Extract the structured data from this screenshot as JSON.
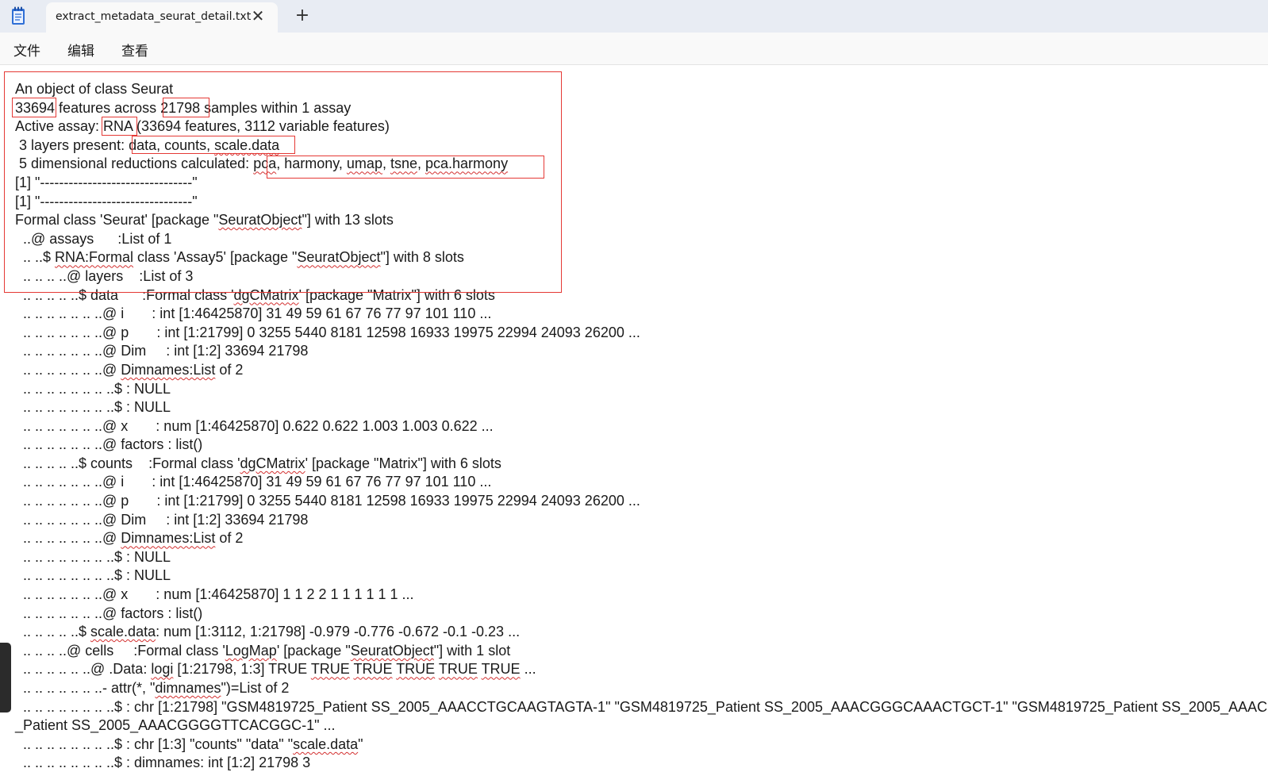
{
  "tab": {
    "title": "extract_metadata_seurat_detail.txt",
    "close_glyph": "✕",
    "new_tab_glyph": "+"
  },
  "icons": {
    "app": "notepad-icon",
    "close": "close-icon",
    "add": "plus-icon"
  },
  "menu": {
    "file": "文件",
    "edit": "编辑",
    "view": "查看"
  },
  "colors": {
    "highlight_box": "#e53935",
    "spellcheck": "#d32f2f",
    "tabbar": "#e8ecf3"
  },
  "lines": [
    [
      {
        "t": "An object of class Seurat"
      }
    ],
    [
      {
        "t": "33694 features across 21798 samples within 1 assay"
      }
    ],
    [
      {
        "t": "Active assay: RNA (33694 features, 3112 variable features)"
      }
    ],
    [
      {
        "t": " 3 layers present: data, counts, "
      },
      {
        "t": "scale.data",
        "s": 1
      }
    ],
    [
      {
        "t": " 5 dimensional reductions calculated: "
      },
      {
        "t": "pca",
        "s": 1
      },
      {
        "t": ", harmony, "
      },
      {
        "t": "umap",
        "s": 1
      },
      {
        "t": ", "
      },
      {
        "t": "tsne",
        "s": 1
      },
      {
        "t": ", "
      },
      {
        "t": "pca.harmony",
        "s": 1
      }
    ],
    [
      {
        "t": "[1] \"--------------------------------\""
      }
    ],
    [
      {
        "t": "[1] \"--------------------------------\""
      }
    ],
    [
      {
        "t": "Formal class 'Seurat' [package \""
      },
      {
        "t": "SeuratObject",
        "s": 1
      },
      {
        "t": "\"] with 13 slots"
      }
    ],
    [
      {
        "t": "  ..@ assays      :List of 1"
      }
    ],
    [
      {
        "t": "  .. ..$ "
      },
      {
        "t": "RNA:Formal",
        "s": 1
      },
      {
        "t": " class 'Assay5' [package \""
      },
      {
        "t": "SeuratObject",
        "s": 1
      },
      {
        "t": "\"] with 8 slots"
      }
    ],
    [
      {
        "t": "  .. .. .. ..@ layers    :List of 3"
      }
    ],
    [
      {
        "t": "  .. .. .. .. ..$ data      :Formal class '"
      },
      {
        "t": "dgCMatrix",
        "s": 1
      },
      {
        "t": "' [package \"Matrix\"] with 6 slots"
      }
    ],
    [
      {
        "t": "  .. .. .. .. .. .. ..@ i       : int [1:46425870] 31 49 59 61 67 76 77 97 101 110 ..."
      }
    ],
    [
      {
        "t": "  .. .. .. .. .. .. ..@ p       : int [1:21799] 0 3255 5440 8181 12598 16933 19975 22994 24093 26200 ..."
      }
    ],
    [
      {
        "t": "  .. .. .. .. .. .. ..@ Dim     : int [1:2] 33694 21798"
      }
    ],
    [
      {
        "t": "  .. .. .. .. .. .. ..@ "
      },
      {
        "t": "Dimnames:List",
        "s": 1
      },
      {
        "t": " of 2"
      }
    ],
    [
      {
        "t": "  .. .. .. .. .. .. .. ..$ : NULL"
      }
    ],
    [
      {
        "t": "  .. .. .. .. .. .. .. ..$ : NULL"
      }
    ],
    [
      {
        "t": "  .. .. .. .. .. .. ..@ x       : num [1:46425870] 0.622 0.622 1.003 1.003 0.622 ..."
      }
    ],
    [
      {
        "t": "  .. .. .. .. .. .. ..@ factors : list()"
      }
    ],
    [
      {
        "t": "  .. .. .. .. ..$ counts    :Formal class '"
      },
      {
        "t": "dgCMatrix",
        "s": 1
      },
      {
        "t": "' [package \"Matrix\"] with 6 slots"
      }
    ],
    [
      {
        "t": "  .. .. .. .. .. .. ..@ i       : int [1:46425870] 31 49 59 61 67 76 77 97 101 110 ..."
      }
    ],
    [
      {
        "t": "  .. .. .. .. .. .. ..@ p       : int [1:21799] 0 3255 5440 8181 12598 16933 19975 22994 24093 26200 ..."
      }
    ],
    [
      {
        "t": "  .. .. .. .. .. .. ..@ Dim     : int [1:2] 33694 21798"
      }
    ],
    [
      {
        "t": "  .. .. .. .. .. .. ..@ "
      },
      {
        "t": "Dimnames:List",
        "s": 1
      },
      {
        "t": " of 2"
      }
    ],
    [
      {
        "t": "  .. .. .. .. .. .. .. ..$ : NULL"
      }
    ],
    [
      {
        "t": "  .. .. .. .. .. .. .. ..$ : NULL"
      }
    ],
    [
      {
        "t": "  .. .. .. .. .. .. ..@ x       : num [1:46425870] 1 1 2 2 1 1 1 1 1 1 ..."
      }
    ],
    [
      {
        "t": "  .. .. .. .. .. .. ..@ factors : list()"
      }
    ],
    [
      {
        "t": "  .. .. .. .. ..$ "
      },
      {
        "t": "scale.data",
        "s": 1
      },
      {
        "t": ": num [1:3112, 1:21798] -0.979 -0.776 -0.672 -0.1 -0.23 ..."
      }
    ],
    [
      {
        "t": "  .. .. .. ..@ cells     :Formal class '"
      },
      {
        "t": "LogMap",
        "s": 1
      },
      {
        "t": "' [package \""
      },
      {
        "t": "SeuratObject",
        "s": 1
      },
      {
        "t": "\"] with 1 slot"
      }
    ],
    [
      {
        "t": "  .. .. .. .. .. ..@ .Data: "
      },
      {
        "t": "logi",
        "s": 1
      },
      {
        "t": " [1:21798, 1:3] TRUE "
      },
      {
        "t": "TRUE",
        "s": 1
      },
      {
        "t": " "
      },
      {
        "t": "TRUE",
        "s": 1
      },
      {
        "t": " "
      },
      {
        "t": "TRUE",
        "s": 1
      },
      {
        "t": " "
      },
      {
        "t": "TRUE",
        "s": 1
      },
      {
        "t": " "
      },
      {
        "t": "TRUE",
        "s": 1
      },
      {
        "t": " ..."
      }
    ],
    [
      {
        "t": "  .. .. .. .. .. .. ..- attr(*, \""
      },
      {
        "t": "dimnames",
        "s": 1
      },
      {
        "t": "\")=List of 2"
      }
    ],
    [
      {
        "t": "  .. .. .. .. .. .. .. ..$ : chr [1:21798] \"GSM4819725_Patient SS_2005_AAACCTGCAAGTAGTA-1\" \"GSM4819725_Patient SS_2005_AAACGGGCAAACTGCT-1\" \"GSM4819725_Patient SS_2005_AAACC"
      }
    ],
    [
      {
        "t": "_Patient SS_2005_AAACGGGGTTCACGGC-1\" ..."
      }
    ],
    [
      {
        "t": "  .. .. .. .. .. .. .. ..$ : chr [1:3] \"counts\" \"data\" \""
      },
      {
        "t": "scale.data",
        "s": 1
      },
      {
        "t": "\""
      }
    ],
    [
      {
        "t": "  .. .. .. .. .. .. .. ..$ : dimnames: int [1:2] 21798 3"
      }
    ]
  ]
}
